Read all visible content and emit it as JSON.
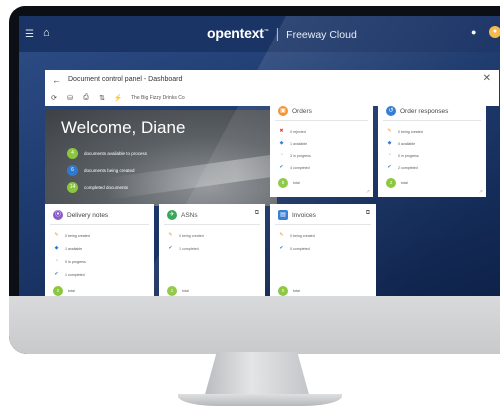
{
  "topbar": {
    "menu_icon": "menu-icon",
    "home_icon": "home-icon",
    "brand_logo": "opentext",
    "brand_tm": "™",
    "brand_sep": "|",
    "brand_product": "Freeway Cloud",
    "user_icon": "user-icon",
    "avatar_icon": "avatar"
  },
  "panel": {
    "back_icon": "←",
    "title": "Document control panel - Dashboard",
    "close_icon": "✕",
    "toolbar_icons": [
      "⟳",
      "⛁",
      "⎙",
      "⇅",
      "⚡"
    ],
    "company": "The Big Fizzy Drinks Co"
  },
  "welcome": {
    "title": "Welcome, Diane",
    "rows": [
      {
        "count": "4",
        "text": "documents available to process",
        "color": "#8cc63f"
      },
      {
        "count": "6",
        "text": "documents being created",
        "color": "#2f7ad1"
      },
      {
        "count": "14",
        "text": "completed documents",
        "color": "#8cc63f"
      }
    ]
  },
  "cards": {
    "orders": {
      "title": "Orders",
      "icon_color": "#f28c28",
      "statuses": [
        {
          "icon": "✖",
          "color": "#d9352c",
          "text": "0 rejected"
        },
        {
          "icon": "◆",
          "color": "#2f7ad1",
          "text": "1 available"
        },
        {
          "icon": "◔",
          "color": "#f28c28",
          "text": "3 in progress"
        },
        {
          "icon": "✔",
          "color": "#2f7ad1",
          "text": "4 completed"
        }
      ],
      "total": "8",
      "total_label": "total"
    },
    "order_responses": {
      "title": "Order responses",
      "icon_color": "#2f7ad1",
      "statuses": [
        {
          "icon": "✎",
          "color": "#f28c28",
          "text": "0 being created"
        },
        {
          "icon": "◆",
          "color": "#2f7ad1",
          "text": "0 available"
        },
        {
          "icon": "◔",
          "color": "#f28c28",
          "text": "0 in progress"
        },
        {
          "icon": "✔",
          "color": "#2f7ad1",
          "text": "2 completed"
        }
      ],
      "total": "2",
      "total_label": "total"
    },
    "delivery_notes": {
      "title": "Delivery notes",
      "icon_color": "#8a5cc9",
      "statuses": [
        {
          "icon": "✎",
          "color": "#f28c28",
          "text": "0 being created"
        },
        {
          "icon": "◆",
          "color": "#2f7ad1",
          "text": "1 available"
        },
        {
          "icon": "◔",
          "color": "#f28c28",
          "text": "0 in progress"
        },
        {
          "icon": "✔",
          "color": "#2f7ad1",
          "text": "1 completed"
        }
      ],
      "total": "2",
      "total_label": "total"
    },
    "asns": {
      "title": "ASNs",
      "icon_color": "#3aa65a",
      "statuses": [
        {
          "icon": "✎",
          "color": "#f28c28",
          "text": "0 being created"
        },
        {
          "icon": "✔",
          "color": "#2f7ad1",
          "text": "1 completed"
        }
      ],
      "total": "1",
      "total_label": "total"
    },
    "invoices": {
      "title": "Invoices",
      "icon_color": "#2f7ad1",
      "statuses": [
        {
          "icon": "✎",
          "color": "#f28c28",
          "text": "0 being created"
        },
        {
          "icon": "✔",
          "color": "#2f7ad1",
          "text": "0 completed"
        }
      ],
      "total": "0",
      "total_label": "total"
    }
  }
}
